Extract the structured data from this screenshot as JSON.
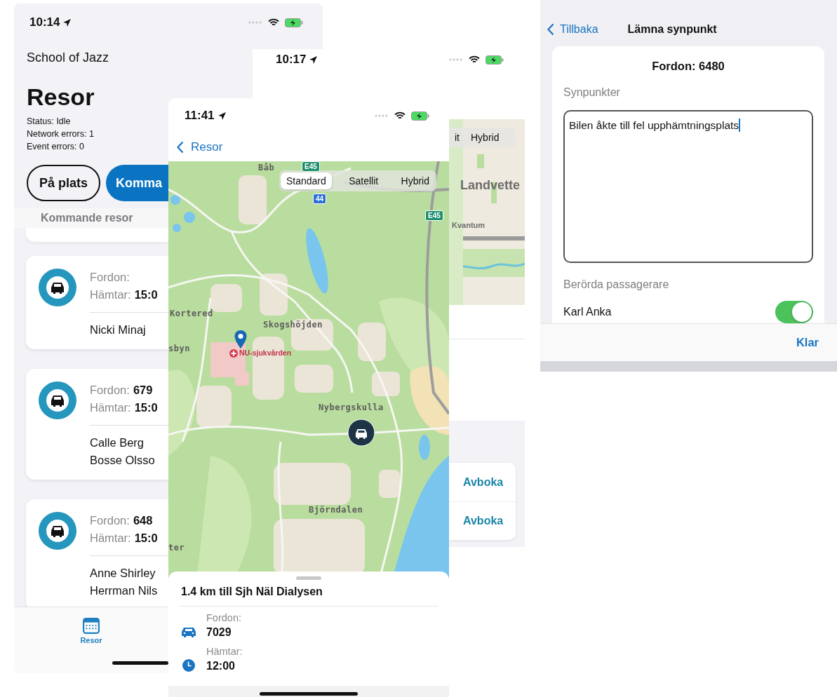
{
  "trip_list_screen": {
    "time": "10:14",
    "org": "School of Jazz",
    "title": "Resor",
    "status_lines": [
      "Status: Idle",
      "Network errors: 1",
      "Event errors: 0"
    ],
    "filters": [
      {
        "label": "På plats",
        "selected": false
      },
      {
        "label": "Komma",
        "selected": true
      }
    ],
    "section": "Kommande resor",
    "trips": [
      {
        "vehicle_label": "Fordon:",
        "pickup_label": "Hämtar:",
        "pickup": "15:0",
        "passengers": [
          "Nicki Minaj"
        ]
      },
      {
        "vehicle_label": "Fordon:",
        "vehicle": "679",
        "pickup_label": "Hämtar:",
        "pickup": "15:0",
        "passengers": [
          "Calle Berg",
          "Bosse Olsso"
        ]
      },
      {
        "vehicle_label": "Fordon:",
        "vehicle": "648",
        "pickup_label": "Hämtar:",
        "pickup": "15:0",
        "passengers": [
          "Anne Shirley",
          "Herrman Nils"
        ]
      }
    ],
    "tabs": [
      {
        "label": "Resor",
        "selected": true
      }
    ]
  },
  "map_screen_behind": {
    "time": "10:17",
    "map_types": [
      {
        "label": "it",
        "selected": false
      },
      {
        "label": "Hybrid",
        "selected": false
      }
    ],
    "place_labels": [
      "Landvette",
      "Kvantum"
    ],
    "actions": [
      "Avboka",
      "Avboka"
    ]
  },
  "map_screen": {
    "time": "11:41",
    "back": "Resor",
    "map_types": [
      {
        "label": "Standard",
        "selected": true
      },
      {
        "label": "Satellit",
        "selected": false
      },
      {
        "label": "Hybrid",
        "selected": false
      }
    ],
    "road_signs": [
      {
        "text": "E45",
        "kind": "european"
      },
      {
        "text": "44",
        "kind": "national"
      },
      {
        "text": "E45",
        "kind": "european"
      }
    ],
    "place_labels": [
      "Båb",
      "Kortered",
      "Skogshöjden",
      "sbyn",
      "Nybergskulla",
      "Björndalen",
      "ter"
    ],
    "hospital": "NU-sjukvården",
    "distance": "1.4 km till Sjh Näl Dialysen",
    "details": [
      {
        "kind": "vehicle",
        "label": "Fordon:",
        "value": "7029"
      },
      {
        "kind": "pickup",
        "label": "Hämtar:",
        "value": "12:00"
      }
    ]
  },
  "feedback_screen": {
    "back": "Tillbaka",
    "title": "Lämna synpunkt",
    "heading": "Fordon: 6480",
    "field_label": "Synpunkter",
    "value": "Bilen åkte till fel upphämtningsplats",
    "passengers_label": "Berörda passagerare",
    "passengers": [
      {
        "name": "Karl Anka",
        "on": true
      }
    ],
    "done": "Klar"
  }
}
